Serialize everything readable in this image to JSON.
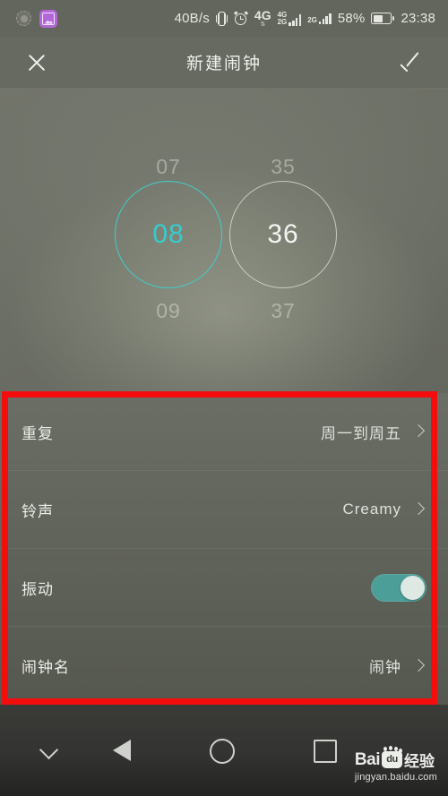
{
  "status_bar": {
    "left_icons": [
      "dashed-circle-icon",
      "purple-app-icon"
    ],
    "network_speed": "40B/s",
    "vibrate_icon": "vibrate-icon",
    "alarm_icon": "alarm-icon",
    "sim1_label_top": "4G",
    "sim1_label_bottom": "2G",
    "sim2_label_top": "4G",
    "sim2_label_bottom": "2G",
    "sim3_label": "2G",
    "battery_percent": "58%",
    "clock": "23:38"
  },
  "app_bar": {
    "close_label": "close-icon",
    "title": "新建闹钟",
    "confirm_label": "check-icon"
  },
  "time_picker": {
    "hour": {
      "prev": "07",
      "selected": "08",
      "next": "09",
      "accent_color": "#35ccd0"
    },
    "minute": {
      "prev": "35",
      "selected": "36",
      "next": "37",
      "accent_color": "#f2f4f0"
    }
  },
  "settings": {
    "rows": [
      {
        "label": "重复",
        "value": "周一到周五",
        "type": "chevron"
      },
      {
        "label": "铃声",
        "value": "Creamy",
        "type": "chevron"
      },
      {
        "label": "振动",
        "value": "",
        "type": "toggle",
        "toggle_on": true,
        "toggle_color": "#4c9e99"
      },
      {
        "label": "闹钟名",
        "value": "闹钟",
        "type": "chevron"
      }
    ]
  },
  "annotation": {
    "color": "#f50d0d",
    "shape": "rectangle"
  },
  "nav_bar": {
    "buttons": [
      "chevron-down-icon",
      "back-icon",
      "home-icon",
      "recents-icon"
    ]
  },
  "watermark": {
    "brand": "Bai",
    "paw_text": "du",
    "suffix": "经验",
    "url": "jingyan.baidu.com"
  }
}
